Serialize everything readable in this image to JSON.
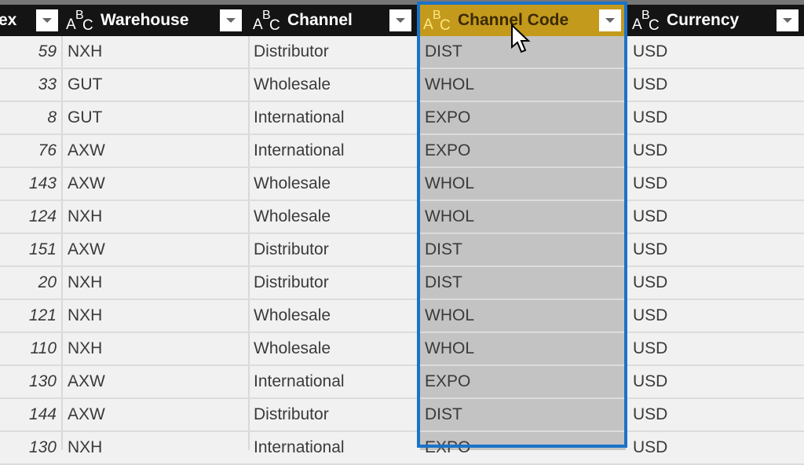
{
  "columns": [
    {
      "label": "ex",
      "type_icon": "none"
    },
    {
      "label": "Warehouse",
      "type_icon": "abc-text-icon"
    },
    {
      "label": "Channel",
      "type_icon": "abc-text-icon"
    },
    {
      "label": "Channel Code",
      "type_icon": "abc-text-icon",
      "selected": true
    },
    {
      "label": "Currency",
      "type_icon": "abc-text-icon"
    }
  ],
  "type_icon_glyphs": {
    "a": "A",
    "b": "B",
    "c": "C"
  },
  "colors": {
    "header_bg": "#141414",
    "selected_header": "#c49a1c",
    "selection_border": "#1a73c8",
    "selected_cells": "#c3c3c3"
  },
  "rows": [
    {
      "index": "59",
      "warehouse": "NXH",
      "channel": "Distributor",
      "code": "DIST",
      "currency": "USD"
    },
    {
      "index": "33",
      "warehouse": "GUT",
      "channel": "Wholesale",
      "code": "WHOL",
      "currency": "USD"
    },
    {
      "index": "8",
      "warehouse": "GUT",
      "channel": "International",
      "code": "EXPO",
      "currency": "USD"
    },
    {
      "index": "76",
      "warehouse": "AXW",
      "channel": "International",
      "code": "EXPO",
      "currency": "USD"
    },
    {
      "index": "143",
      "warehouse": "AXW",
      "channel": "Wholesale",
      "code": "WHOL",
      "currency": "USD"
    },
    {
      "index": "124",
      "warehouse": "NXH",
      "channel": "Wholesale",
      "code": "WHOL",
      "currency": "USD"
    },
    {
      "index": "151",
      "warehouse": "AXW",
      "channel": "Distributor",
      "code": "DIST",
      "currency": "USD"
    },
    {
      "index": "20",
      "warehouse": "NXH",
      "channel": "Distributor",
      "code": "DIST",
      "currency": "USD"
    },
    {
      "index": "121",
      "warehouse": "NXH",
      "channel": "Wholesale",
      "code": "WHOL",
      "currency": "USD"
    },
    {
      "index": "110",
      "warehouse": "NXH",
      "channel": "Wholesale",
      "code": "WHOL",
      "currency": "USD"
    },
    {
      "index": "130",
      "warehouse": "AXW",
      "channel": "International",
      "code": "EXPO",
      "currency": "USD"
    },
    {
      "index": "144",
      "warehouse": "AXW",
      "channel": "Distributor",
      "code": "DIST",
      "currency": "USD"
    },
    {
      "index": "130",
      "warehouse": "NXH",
      "channel": "International",
      "code": "EXPO",
      "currency": "USD"
    }
  ]
}
